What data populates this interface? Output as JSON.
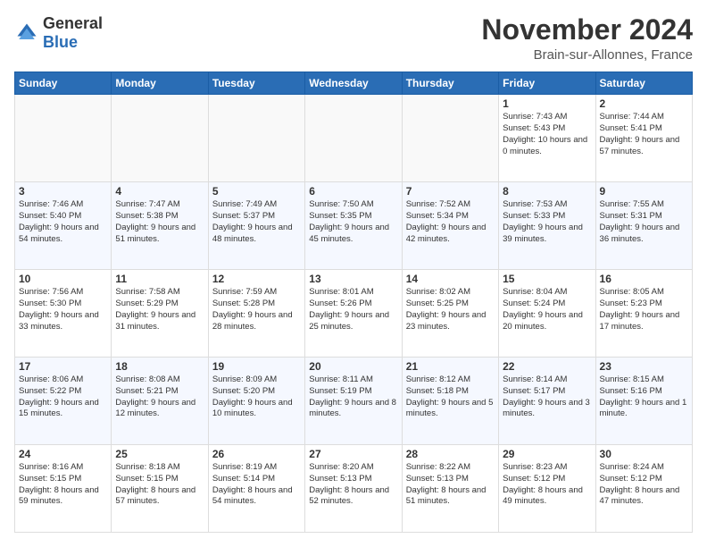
{
  "logo": {
    "text_general": "General",
    "text_blue": "Blue"
  },
  "title": "November 2024",
  "location": "Brain-sur-Allonnes, France",
  "days_of_week": [
    "Sunday",
    "Monday",
    "Tuesday",
    "Wednesday",
    "Thursday",
    "Friday",
    "Saturday"
  ],
  "weeks": [
    [
      {
        "day": "",
        "empty": true
      },
      {
        "day": "",
        "empty": true
      },
      {
        "day": "",
        "empty": true
      },
      {
        "day": "",
        "empty": true
      },
      {
        "day": "",
        "empty": true
      },
      {
        "day": "1",
        "sunrise": "Sunrise: 7:43 AM",
        "sunset": "Sunset: 5:43 PM",
        "daylight": "Daylight: 10 hours and 0 minutes."
      },
      {
        "day": "2",
        "sunrise": "Sunrise: 7:44 AM",
        "sunset": "Sunset: 5:41 PM",
        "daylight": "Daylight: 9 hours and 57 minutes."
      }
    ],
    [
      {
        "day": "3",
        "sunrise": "Sunrise: 7:46 AM",
        "sunset": "Sunset: 5:40 PM",
        "daylight": "Daylight: 9 hours and 54 minutes."
      },
      {
        "day": "4",
        "sunrise": "Sunrise: 7:47 AM",
        "sunset": "Sunset: 5:38 PM",
        "daylight": "Daylight: 9 hours and 51 minutes."
      },
      {
        "day": "5",
        "sunrise": "Sunrise: 7:49 AM",
        "sunset": "Sunset: 5:37 PM",
        "daylight": "Daylight: 9 hours and 48 minutes."
      },
      {
        "day": "6",
        "sunrise": "Sunrise: 7:50 AM",
        "sunset": "Sunset: 5:35 PM",
        "daylight": "Daylight: 9 hours and 45 minutes."
      },
      {
        "day": "7",
        "sunrise": "Sunrise: 7:52 AM",
        "sunset": "Sunset: 5:34 PM",
        "daylight": "Daylight: 9 hours and 42 minutes."
      },
      {
        "day": "8",
        "sunrise": "Sunrise: 7:53 AM",
        "sunset": "Sunset: 5:33 PM",
        "daylight": "Daylight: 9 hours and 39 minutes."
      },
      {
        "day": "9",
        "sunrise": "Sunrise: 7:55 AM",
        "sunset": "Sunset: 5:31 PM",
        "daylight": "Daylight: 9 hours and 36 minutes."
      }
    ],
    [
      {
        "day": "10",
        "sunrise": "Sunrise: 7:56 AM",
        "sunset": "Sunset: 5:30 PM",
        "daylight": "Daylight: 9 hours and 33 minutes."
      },
      {
        "day": "11",
        "sunrise": "Sunrise: 7:58 AM",
        "sunset": "Sunset: 5:29 PM",
        "daylight": "Daylight: 9 hours and 31 minutes."
      },
      {
        "day": "12",
        "sunrise": "Sunrise: 7:59 AM",
        "sunset": "Sunset: 5:28 PM",
        "daylight": "Daylight: 9 hours and 28 minutes."
      },
      {
        "day": "13",
        "sunrise": "Sunrise: 8:01 AM",
        "sunset": "Sunset: 5:26 PM",
        "daylight": "Daylight: 9 hours and 25 minutes."
      },
      {
        "day": "14",
        "sunrise": "Sunrise: 8:02 AM",
        "sunset": "Sunset: 5:25 PM",
        "daylight": "Daylight: 9 hours and 23 minutes."
      },
      {
        "day": "15",
        "sunrise": "Sunrise: 8:04 AM",
        "sunset": "Sunset: 5:24 PM",
        "daylight": "Daylight: 9 hours and 20 minutes."
      },
      {
        "day": "16",
        "sunrise": "Sunrise: 8:05 AM",
        "sunset": "Sunset: 5:23 PM",
        "daylight": "Daylight: 9 hours and 17 minutes."
      }
    ],
    [
      {
        "day": "17",
        "sunrise": "Sunrise: 8:06 AM",
        "sunset": "Sunset: 5:22 PM",
        "daylight": "Daylight: 9 hours and 15 minutes."
      },
      {
        "day": "18",
        "sunrise": "Sunrise: 8:08 AM",
        "sunset": "Sunset: 5:21 PM",
        "daylight": "Daylight: 9 hours and 12 minutes."
      },
      {
        "day": "19",
        "sunrise": "Sunrise: 8:09 AM",
        "sunset": "Sunset: 5:20 PM",
        "daylight": "Daylight: 9 hours and 10 minutes."
      },
      {
        "day": "20",
        "sunrise": "Sunrise: 8:11 AM",
        "sunset": "Sunset: 5:19 PM",
        "daylight": "Daylight: 9 hours and 8 minutes."
      },
      {
        "day": "21",
        "sunrise": "Sunrise: 8:12 AM",
        "sunset": "Sunset: 5:18 PM",
        "daylight": "Daylight: 9 hours and 5 minutes."
      },
      {
        "day": "22",
        "sunrise": "Sunrise: 8:14 AM",
        "sunset": "Sunset: 5:17 PM",
        "daylight": "Daylight: 9 hours and 3 minutes."
      },
      {
        "day": "23",
        "sunrise": "Sunrise: 8:15 AM",
        "sunset": "Sunset: 5:16 PM",
        "daylight": "Daylight: 9 hours and 1 minute."
      }
    ],
    [
      {
        "day": "24",
        "sunrise": "Sunrise: 8:16 AM",
        "sunset": "Sunset: 5:15 PM",
        "daylight": "Daylight: 8 hours and 59 minutes."
      },
      {
        "day": "25",
        "sunrise": "Sunrise: 8:18 AM",
        "sunset": "Sunset: 5:15 PM",
        "daylight": "Daylight: 8 hours and 57 minutes."
      },
      {
        "day": "26",
        "sunrise": "Sunrise: 8:19 AM",
        "sunset": "Sunset: 5:14 PM",
        "daylight": "Daylight: 8 hours and 54 minutes."
      },
      {
        "day": "27",
        "sunrise": "Sunrise: 8:20 AM",
        "sunset": "Sunset: 5:13 PM",
        "daylight": "Daylight: 8 hours and 52 minutes."
      },
      {
        "day": "28",
        "sunrise": "Sunrise: 8:22 AM",
        "sunset": "Sunset: 5:13 PM",
        "daylight": "Daylight: 8 hours and 51 minutes."
      },
      {
        "day": "29",
        "sunrise": "Sunrise: 8:23 AM",
        "sunset": "Sunset: 5:12 PM",
        "daylight": "Daylight: 8 hours and 49 minutes."
      },
      {
        "day": "30",
        "sunrise": "Sunrise: 8:24 AM",
        "sunset": "Sunset: 5:12 PM",
        "daylight": "Daylight: 8 hours and 47 minutes."
      }
    ]
  ]
}
